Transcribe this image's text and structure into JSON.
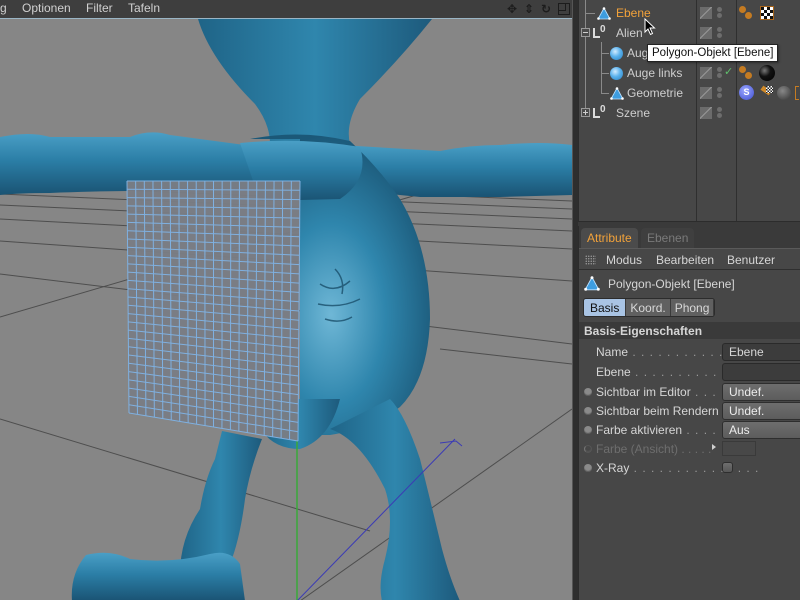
{
  "viewport": {
    "menu": [
      "g",
      "Optionen",
      "Filter",
      "Tafeln"
    ],
    "nav_icons": [
      "move-view-icon",
      "zoom-view-icon",
      "rotate-view-icon",
      "toggle-view-icon"
    ],
    "mesh_color": "#2e7fa6",
    "wireframe_color": "#7fb0e0",
    "background_color": "#868686"
  },
  "object_manager": {
    "objects": [
      {
        "name": "Ebene",
        "type": "polygon",
        "depth": 1,
        "active": true,
        "tags": [
          "phong",
          "checker-material"
        ]
      },
      {
        "name": "Alien",
        "type": "null",
        "depth": 0,
        "expanded": true,
        "tags": []
      },
      {
        "name": "Auge rechts",
        "display": "Aug",
        "type": "sphere",
        "depth": 1,
        "tags": []
      },
      {
        "name": "Auge links",
        "type": "sphere",
        "depth": 1,
        "checked": true,
        "tags": [
          "phong",
          "black-material"
        ]
      },
      {
        "name": "Geometrie",
        "type": "polygon",
        "depth": 1,
        "tags": [
          "sculpt",
          "material",
          "material-2"
        ]
      },
      {
        "name": "Szene",
        "type": "null",
        "depth": 0,
        "expanded": false,
        "tags": []
      }
    ],
    "tooltip": "Polygon-Objekt [Ebene]",
    "active_color": "#f2a23a"
  },
  "attribute_manager": {
    "tabs": [
      {
        "label": "Attribute",
        "active": true
      },
      {
        "label": "Ebenen",
        "active": false
      }
    ],
    "menu": [
      "Modus",
      "Bearbeiten",
      "Benutzer"
    ],
    "object_title": "Polygon-Objekt [Ebene]",
    "subtabs": [
      {
        "label": "Basis",
        "active": true
      },
      {
        "label": "Koord.",
        "active": false
      },
      {
        "label": "Phong",
        "active": false
      }
    ],
    "section_title": "Basis-Eigenschaften",
    "fields": [
      {
        "label": "Name",
        "dots": " . . . . . . . . . . . . . . .",
        "type": "text",
        "value": "Ebene",
        "radio": false
      },
      {
        "label": "Ebene",
        "dots": " . . . . . . . . . . . . . . .",
        "type": "text",
        "value": "",
        "radio": false
      },
      {
        "label": "Sichtbar im Editor",
        "dots": " . . . .",
        "type": "dropdown",
        "value": "Undef.",
        "radio": true
      },
      {
        "label": "Sichtbar beim Rendern",
        "dots": "",
        "type": "dropdown",
        "value": "Undef.",
        "radio": true
      },
      {
        "label": "Farbe aktivieren",
        "dots": " . . . . . . .",
        "type": "dropdown",
        "value": "Aus",
        "radio": true
      },
      {
        "label": "Farbe (Ansicht)",
        "dots": " . . . . .",
        "type": "color",
        "value": "",
        "radio": true,
        "disabled": true
      },
      {
        "label": "X-Ray",
        "dots": " . . . . . . . . . . . . . . .",
        "type": "checkbox",
        "value": false,
        "radio": true
      }
    ]
  }
}
